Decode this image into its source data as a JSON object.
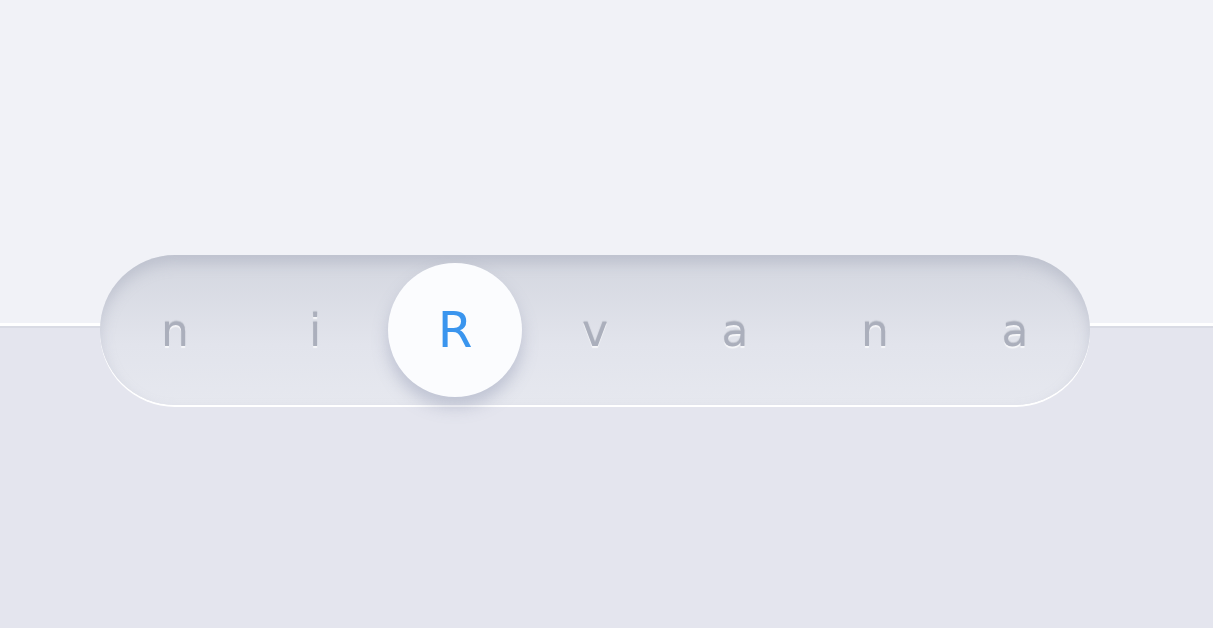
{
  "tabs": [
    {
      "label": "n",
      "selected": false
    },
    {
      "label": "i",
      "selected": false
    },
    {
      "label": "R",
      "selected": true
    },
    {
      "label": "v",
      "selected": false
    },
    {
      "label": "a",
      "selected": false
    },
    {
      "label": "n",
      "selected": false
    },
    {
      "label": "a",
      "selected": false
    }
  ]
}
